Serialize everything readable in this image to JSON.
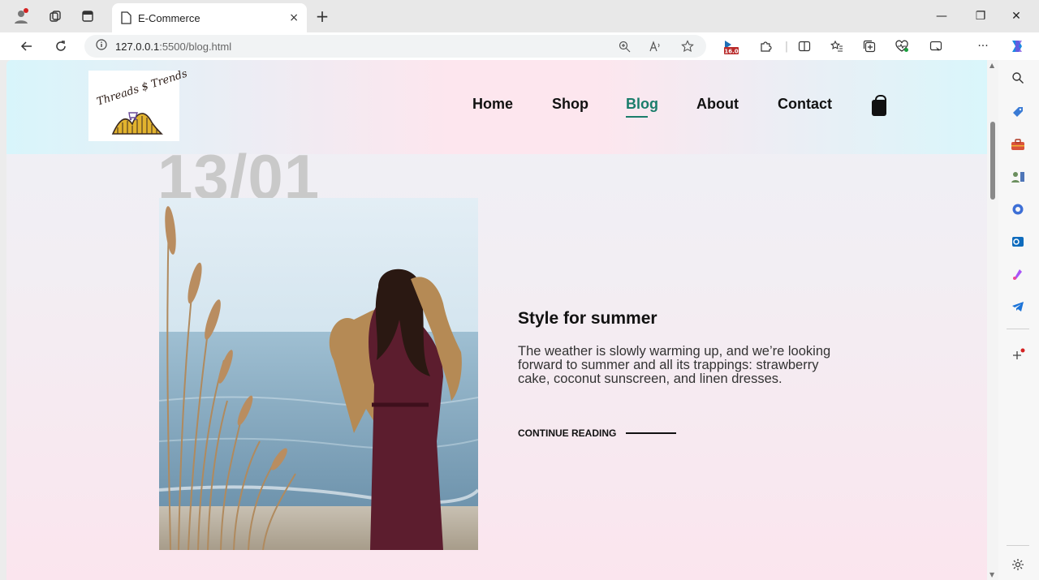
{
  "browser": {
    "tab_title": "E-Commerce",
    "tab_close": "×",
    "new_tab": "+",
    "url_host": "127.0.0.1",
    "url_path": ":5500/blog.html",
    "badge_value": "16.0",
    "more_dots": "···",
    "win_min": "—",
    "win_restore": "❐",
    "win_close": "✕"
  },
  "site": {
    "logo_text": "Threads $ Trends",
    "nav": [
      {
        "label": "Home"
      },
      {
        "label": "Shop"
      },
      {
        "label": "Blog"
      },
      {
        "label": "About"
      },
      {
        "label": "Contact"
      }
    ],
    "active_nav": "Blog",
    "accent_color": "#1a7d6b"
  },
  "post": {
    "date": "13/01",
    "title": "Style for summer",
    "excerpt": "The weather is slowly warming up, and we’re looking forward to summer and all its trappings: strawberry cake, coconut sunscreen, and linen dresses.",
    "continue_label": "CONTINUE READING"
  }
}
